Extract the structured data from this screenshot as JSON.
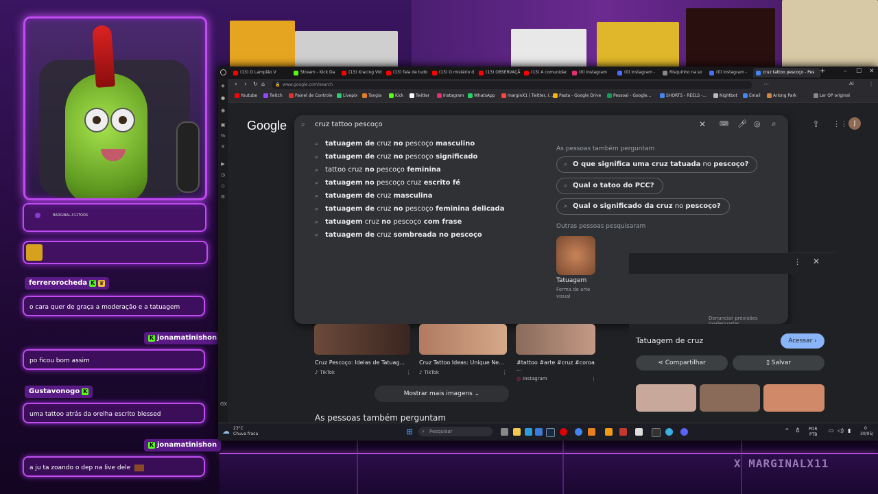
{
  "stream": {
    "brand": "MARGINALX11",
    "overlay_small_text": "BARGINAL.X11TOOS"
  },
  "chat": [
    {
      "user": "ferrerorocheda",
      "message": "o cara quer de graça a moderação e a tatuagem"
    },
    {
      "user": "jonamatinishon",
      "message": "po ficou bom assim"
    },
    {
      "user": "Gustavonogo",
      "message": "uma tattoo atrás da orelha escrito blessed"
    },
    {
      "user": "jonamatinishon",
      "message": "a ju ta zoando o dep na live dele"
    }
  ],
  "browser": {
    "tabs": [
      {
        "label": "(13) O Lampião V",
        "color": "#ff0000"
      },
      {
        "label": "Stream - Kick Da",
        "color": "#53fc18"
      },
      {
        "label": "(13) Xracing Vid",
        "color": "#ff0000"
      },
      {
        "label": "(13) fala de tudo",
        "color": "#ff0000"
      },
      {
        "label": "(13) O mistério d",
        "color": "#ff0000"
      },
      {
        "label": "(13) OBSERVAÇÃ",
        "color": "#ff0000"
      },
      {
        "label": "(13) A comunidad",
        "color": "#ff0000"
      },
      {
        "label": "(0) Instagram",
        "color": "#e1306c"
      },
      {
        "label": "(0) Instagram -",
        "color": "#4a6cf7"
      },
      {
        "label": "Risquinho na so",
        "color": "#888888"
      },
      {
        "label": "(0) Instagram -",
        "color": "#4a6cf7"
      },
      {
        "label": "cruz tattoo pescoço - Pes",
        "color": "#4285f4"
      }
    ],
    "url": "www.google.com/search",
    "bookmarks": [
      {
        "label": "Youtube",
        "color": "#ff0000"
      },
      {
        "label": "Twitch",
        "color": "#9146ff"
      },
      {
        "label": "Painel de Controle",
        "color": "#d33"
      },
      {
        "label": "Livepix",
        "color": "#2ecc71"
      },
      {
        "label": "Tangia",
        "color": "#e67e22"
      },
      {
        "label": "Kick",
        "color": "#53fc18"
      },
      {
        "label": "Twitter",
        "color": "#ffffff"
      },
      {
        "label": "Instagram",
        "color": "#e1306c"
      },
      {
        "label": "WhatsApp",
        "color": "#25d366"
      },
      {
        "label": "marginX1 | Twitter, I...",
        "color": "#ff4444"
      },
      {
        "label": "Pasta - Google Drive",
        "color": "#f4b400"
      },
      {
        "label": "Pessoal - Google...",
        "color": "#0f9d58"
      },
      {
        "label": "SHORTS - REELS -...",
        "color": "#4285f4"
      },
      {
        "label": "Nightbot",
        "color": "#bbbbbb"
      },
      {
        "label": "Email",
        "color": "#4285f4"
      },
      {
        "label": "Arlong Park",
        "color": "#cc8844"
      },
      {
        "label": "Ler OP original",
        "color": "#888888"
      }
    ]
  },
  "google": {
    "logo": "Google",
    "query": "cruz tattoo pescoço",
    "suggestions": [
      {
        "plain": "tatuagem de",
        "mid": " cruz ",
        "post": "no",
        "rest": " pescoço",
        "tail": " masculino"
      },
      {
        "plain": "tatuagem de",
        "mid": " cruz ",
        "post": "no",
        "rest": " pescoço",
        "tail": " significado"
      },
      {
        "plain": "tattoo cruz",
        "mid": " ",
        "post": "no",
        "rest": " pescoço",
        "tail": " feminina"
      },
      {
        "plain": "tatuagem",
        "mid": " ",
        "post": "no",
        "rest": " pescoço cruz",
        "tail": " escrito fé"
      },
      {
        "plain": "tatuagem de",
        "mid": " cruz ",
        "post": "",
        "rest": "",
        "tail": "masculina"
      },
      {
        "plain": "tatuagem de",
        "mid": " cruz ",
        "post": "no",
        "rest": " pescoço",
        "tail": " feminina delicada"
      },
      {
        "plain": "tatuagem",
        "mid": " cruz ",
        "post": "no",
        "rest": " pescoço",
        "tail": " com frase"
      },
      {
        "plain": "tatuagem de",
        "mid": " cruz ",
        "post": "",
        "rest": "",
        "tail": "sombreada no pescoço"
      }
    ],
    "paa_title": "As pessoas também perguntam",
    "paa": [
      {
        "bold": "O que significa uma cruz tatuada",
        "mid": " no ",
        "end": "pescoço?"
      },
      {
        "bold": "Qual o tatoo do PCC?",
        "mid": "",
        "end": ""
      },
      {
        "bold": "Qual o significado da cruz",
        "mid": " no ",
        "end": "pescoço?"
      }
    ],
    "others_title": "Outras pessoas pesquisaram",
    "entity": {
      "name": "Tatuagem",
      "desc": "Forma de arte visual"
    },
    "report": "Denunciar previsões inadequadas",
    "results": [
      {
        "title": "Cruz Pescoço: Ideias de Tatuag...",
        "source": "TikTok"
      },
      {
        "title": "Cruz Tattoo Ideas: Unique Ne...",
        "source": "TikTok"
      },
      {
        "title": "#tattoo #arte #cruz #coroa ...",
        "source": "Instagram"
      }
    ],
    "more_images": "Mostrar mais imagens",
    "paa_bottom": "As pessoas também perguntam",
    "knowledge_panel": {
      "title": "Tatuagem de cruz",
      "access": "Acessar",
      "share": "Compartilhar",
      "save": "Salvar"
    }
  },
  "taskbar": {
    "temp": "23°C",
    "weather": "Chuva fraca",
    "search_placeholder": "Pesquisar",
    "lang1": "POR",
    "lang2": "PTB",
    "clock": "0",
    "date": "30/05/"
  }
}
